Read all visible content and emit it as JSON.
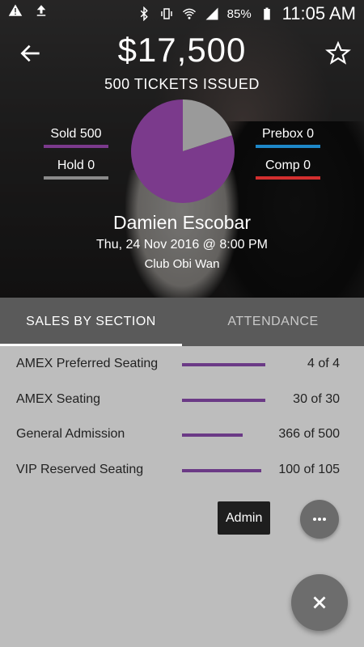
{
  "status_bar": {
    "left_icons": [
      "warning-icon",
      "upload-icon"
    ],
    "right_icons": [
      "bluetooth-icon",
      "vibrate-icon",
      "wifi-icon",
      "signal-icon",
      "battery-icon"
    ],
    "battery_percent": "85%",
    "time": "11:05 AM"
  },
  "header": {
    "revenue": "$17,500",
    "tickets_issued": "500 TICKETS ISSUED",
    "back_icon": "arrow-left-icon",
    "favorite_icon": "star-outline-icon"
  },
  "breakdown": {
    "sold": {
      "label": "Sold 500",
      "color": "#7b3a8c",
      "value": 500
    },
    "hold": {
      "label": "Hold 0",
      "color": "#8a8a8a",
      "value": 0
    },
    "prebox": {
      "label": "Prebox 0",
      "color": "#1e88c8",
      "value": 0
    },
    "comp": {
      "label": "Comp 0",
      "color": "#d32f2f",
      "value": 0
    },
    "pie_segments": [
      {
        "name": "sold",
        "fraction": 0.8,
        "color": "#7b3a8c"
      },
      {
        "name": "remaining",
        "fraction": 0.2,
        "color": "#9a9a9a"
      }
    ]
  },
  "event": {
    "performer": "Damien Escobar",
    "datetime": "Thu, 24 Nov 2016 @ 8:00 PM",
    "venue": "Club Obi Wan"
  },
  "tabs": [
    {
      "label": "SALES BY SECTION",
      "active": true
    },
    {
      "label": "ATTENDANCE",
      "active": false
    }
  ],
  "sections": [
    {
      "name": "AMEX Preferred Seating",
      "count": "4 of 4",
      "progress": 1.0
    },
    {
      "name": "AMEX Seating",
      "count": "30 of 30",
      "progress": 1.0
    },
    {
      "name": "General Admission",
      "count": "366 of 500",
      "progress": 0.732
    },
    {
      "name": "VIP Reserved Seating",
      "count": "100 of 105",
      "progress": 0.952
    }
  ],
  "fab": {
    "tooltip": "Admin",
    "more_icon": "more-horizontal-icon",
    "close_icon": "close-icon"
  },
  "colors": {
    "accent": "#6b3a86",
    "tab_bar": "#5a5a5a",
    "overlay": "#bdbdbd"
  }
}
